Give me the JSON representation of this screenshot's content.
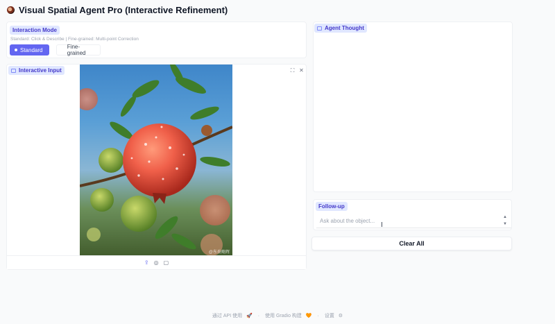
{
  "app": {
    "title": "Visual Spatial Agent Pro (Interactive Refinement)",
    "icon": "eye-icon"
  },
  "interaction_mode": {
    "label": "Interaction Mode",
    "description": "Standard: Click & Describe | Fine-grained: Multi-point Correction",
    "options": [
      {
        "label": "Standard",
        "selected": true
      },
      {
        "label": "Fine-grained",
        "selected": false
      }
    ]
  },
  "interactive_input": {
    "label": "Interactive Input",
    "image_description": "pomegranate on branch with water droplets",
    "watermark": "@东岳鲍辉",
    "toolbar": {
      "fullscreen_icon": "fullscreen-icon",
      "close_icon": "close-icon"
    },
    "bottom_icons": [
      "upload-icon",
      "webcam-icon",
      "clipboard-icon"
    ]
  },
  "agent_thought": {
    "label": "Agent Thought"
  },
  "follow_up": {
    "label": "Follow-up",
    "placeholder": "Ask about the object..."
  },
  "clear_button": {
    "label": "Clear All"
  },
  "footer": {
    "api": "通过 API 使用",
    "gradio": "使用 Gradio 构建",
    "settings": "设置",
    "separator": "·"
  },
  "colors": {
    "accent": "#6366f1",
    "label_bg": "#e0e7ff",
    "label_fg": "#4338ca"
  }
}
